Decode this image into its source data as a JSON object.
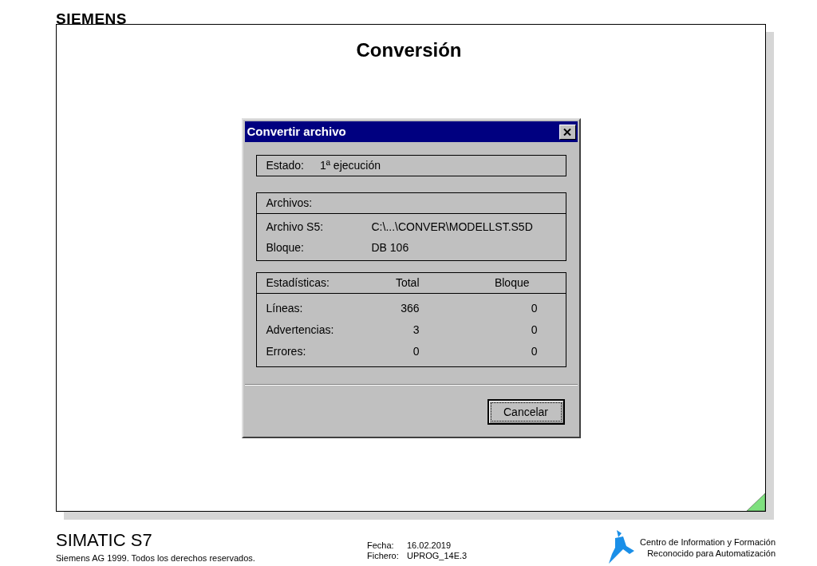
{
  "brand": "SIEMENS",
  "slide": {
    "title": "Conversión"
  },
  "dialog": {
    "title": "Convertir archivo",
    "status": {
      "label": "Estado:",
      "value": "1ª ejecución"
    },
    "files": {
      "heading": "Archivos:",
      "rows": [
        {
          "label": "Archivo S5:",
          "value": "C:\\...\\CONVER\\MODELLST.S5D"
        },
        {
          "label": "Bloque:",
          "value": "DB 106"
        }
      ]
    },
    "statistics": {
      "columns": [
        "Estadísticas:",
        "Total",
        "Bloque"
      ],
      "rows": [
        [
          "Líneas:",
          "366",
          "0"
        ],
        [
          "Advertencias:",
          "3",
          "0"
        ],
        [
          "Errores:",
          "0",
          "0"
        ]
      ]
    },
    "buttons": [
      {
        "label": "Cancelar",
        "focused": true
      }
    ]
  },
  "footer": {
    "product": "SIMATIC S7",
    "copyright": "Siemens AG 1999. Todos los derechos reservados.",
    "fields": [
      {
        "label": "Fecha:",
        "value": "16.02.2019"
      },
      {
        "label": "Fichero:",
        "value": "UPROG_14E.3"
      }
    ],
    "center_lines": [
      "Centro de Information y Formación",
      "Reconocido para Automatización"
    ]
  }
}
